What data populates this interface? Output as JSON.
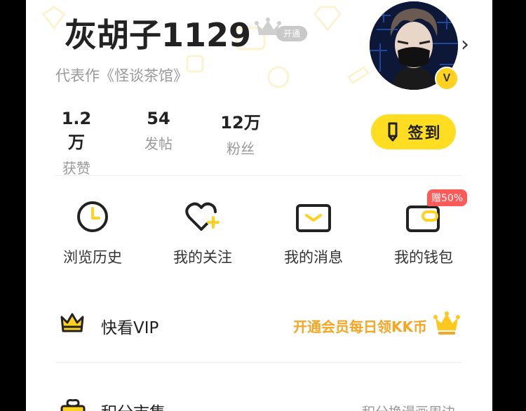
{
  "profile": {
    "username": "灰胡子1129",
    "vip_open_label": "开通",
    "representative_work": "代表作《怪谈茶馆》",
    "verified_badge": "V",
    "chevron_icon": "chevron-right-icon"
  },
  "stats": [
    {
      "value": "1.2万",
      "label": "获赞"
    },
    {
      "value": "54",
      "label": "发帖"
    },
    {
      "value": "12万",
      "label": "粉丝"
    }
  ],
  "checkin": {
    "label": "签到"
  },
  "shortcuts": [
    {
      "label": "浏览历史",
      "icon": "clock-icon"
    },
    {
      "label": "我的关注",
      "icon": "heart-plus-icon"
    },
    {
      "label": "我的消息",
      "icon": "envelope-icon"
    },
    {
      "label": "我的钱包",
      "icon": "wallet-icon",
      "badge": "赠50%"
    }
  ],
  "vip_row": {
    "title": "快看VIP",
    "promo": "开通会员每日领KK币"
  },
  "points_row": {
    "title": "积分市集",
    "promo": "积分换漫画周边"
  },
  "colors": {
    "accent_yellow": "#ffdd21",
    "promo_orange": "#f5a623",
    "badge_red": "#ff5a5a"
  }
}
